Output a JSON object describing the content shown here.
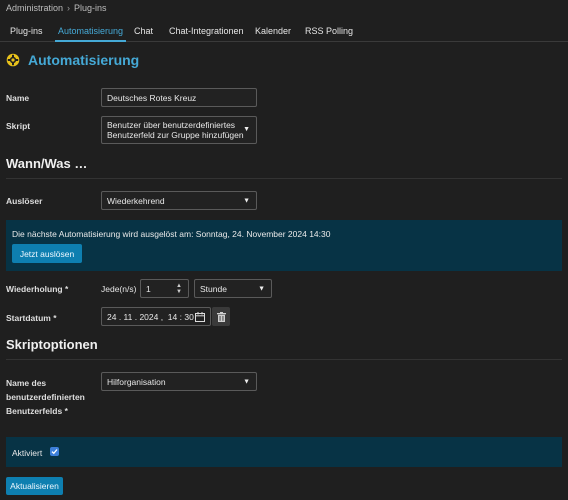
{
  "breadcrumb": {
    "items": [
      "Administration",
      "Plug-ins"
    ],
    "separator": "›"
  },
  "tabs": [
    {
      "label": "Plug-ins",
      "active": false
    },
    {
      "label": "Automatisierung",
      "active": true
    },
    {
      "label": "Chat",
      "active": false
    },
    {
      "label": "Chat-Integrationen",
      "active": false
    },
    {
      "label": "Kalender",
      "active": false
    },
    {
      "label": "RSS Polling",
      "active": false
    }
  ],
  "page": {
    "title": "Automatisierung",
    "icon": "gear-icon"
  },
  "form": {
    "name_label": "Name",
    "name_value": "Deutsches Rotes Kreuz",
    "script_label": "Skript",
    "script_value_line1": "Benutzer über benutzerdefiniertes",
    "script_value_line2": "Benutzerfeld zur Gruppe hinzufügen"
  },
  "when": {
    "heading": "Wann/Was …",
    "trigger_label": "Auslöser",
    "trigger_value": "Wiederkehrend",
    "next_run_text": "Die nächste Automatisierung wird ausgelöst am: Sonntag, 24. November 2024 14:30",
    "trigger_now_button": "Jetzt auslösen",
    "repeat_label": "Wiederholung",
    "repeat_required": "*",
    "every_label": "Jede(n/s)",
    "every_value": "1",
    "unit_value": "Stunde",
    "start_label": "Startdatum",
    "start_required": "*",
    "start_date": "24 . 11 . 2024 ,  14 : 30"
  },
  "options": {
    "heading": "Skriptoptionen",
    "field_label_line1": "Name des",
    "field_label_line2": "benutzerdefinierten",
    "field_label_line3": "Benutzerfelds",
    "field_required": "*",
    "field_value": "Hilforganisation"
  },
  "enabled": {
    "label": "Aktiviert",
    "checked": true
  },
  "actions": {
    "update_button": "Aktualisieren"
  },
  "colors": {
    "accent": "#45a9d6",
    "banner": "#073345",
    "button": "#0e7fb0",
    "background": "#1f1f1f"
  }
}
